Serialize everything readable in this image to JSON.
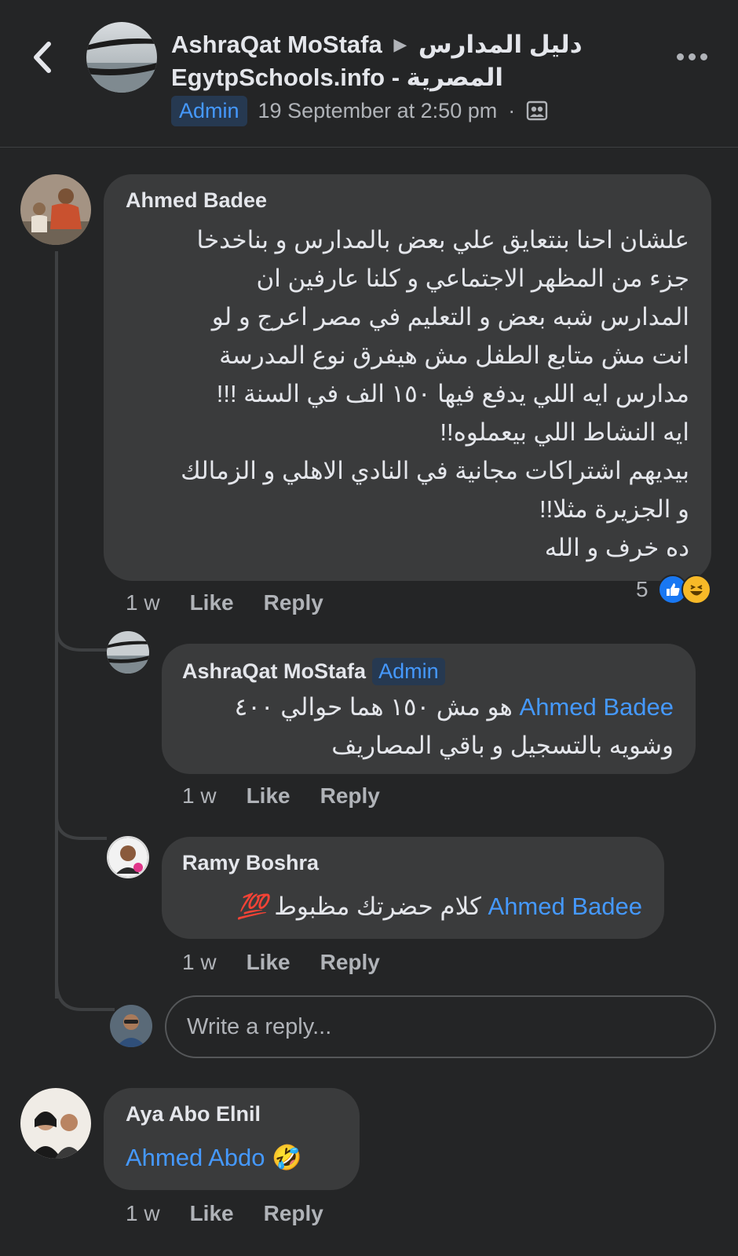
{
  "header": {
    "author": "AshraQat MoStafa",
    "group_line1": "دليل المدارس",
    "group_line2": "EgytpSchools.info - المصرية",
    "badge": "Admin",
    "timestamp": "19 September at 2:50 pm",
    "separator": "·",
    "privacy_icon": "group-members-icon"
  },
  "comments": [
    {
      "author": "Ahmed Badee",
      "lines": [
        "علشان احنا بنتعايق علي بعض بالمدارس و بناخدخا",
        "جزء من المظهر الاجتماعي و كلنا عارفين ان",
        "المدارس شبه بعض و التعليم في مصر اعرج و لو",
        "انت مش متابع الطفل مش هيفرق نوع المدرسة",
        "مدارس ايه اللي يدفع فيها ١٥٠ الف في السنة !!!",
        "ايه النشاط اللي بيعملوه!!",
        "بيديهم اشتراكات مجانية في النادي الاهلي و الزمالك",
        "و الجزيرة مثلا!!",
        "ده خرف و الله"
      ],
      "time": "1 w",
      "like": "Like",
      "reply": "Reply",
      "reaction_count": "5",
      "reaction_icons": [
        "like-icon",
        "haha-icon"
      ]
    }
  ],
  "replies": [
    {
      "author": "AshraQat MoStafa",
      "badge": "Admin",
      "mention": "Ahmed Badee",
      "text_line1": "هو مش ١٥٠ هما حوالي ٤٠٠",
      "text_line2": "وشويه بالتسجيل و باقي المصاريف",
      "time": "1 w",
      "like": "Like",
      "reply": "Reply"
    },
    {
      "author": "Ramy Boshra",
      "mention": "Ahmed Badee",
      "text": "كلام حضرتك مظبوط",
      "emoji": "💯",
      "time": "1 w",
      "like": "Like",
      "reply": "Reply"
    }
  ],
  "reply_box": {
    "placeholder": "Write a reply..."
  },
  "last_comment": {
    "author": "Aya Abo Elnil",
    "mention": "Ahmed Abdo",
    "emoji": "🤣",
    "time": "1 w",
    "like": "Like",
    "reply": "Reply"
  },
  "colors": {
    "background": "#242526",
    "bubble": "#3a3b3c",
    "link": "#4599ff",
    "secondary_text": "#b0b3b8",
    "like_blue": "#1877f2",
    "haha_yellow": "#f7b928"
  }
}
